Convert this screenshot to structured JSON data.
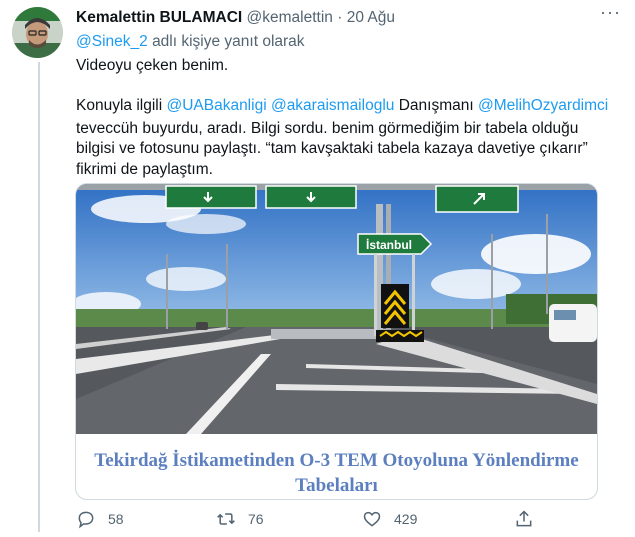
{
  "tweet": {
    "display_name": "Kemalettin BULAMACI",
    "handle": "@kemalettin",
    "separator": "·",
    "date": "20 Ağu",
    "reply_to_handle": "@Sinek_2",
    "reply_to_suffix": "adlı kişiye yanıt olarak",
    "line1": "Videoyu çeken benim.",
    "line2_prefix": "Konuyla ilgili ",
    "mention1": "@UABakanligi",
    "mention2": "@akaraismailoglu",
    "line2_mid": " Danışmanı ",
    "mention3": "@MelihOzyardimci",
    "line3": "teveccüh buyurdu, aradı. Bilgi sordu. benim görmediğim bir tabela olduğu",
    "line4": "bilgisi ve fotosunu paylaştı. “tam kavşaktaki tabela kazaya davetiye çıkarır”",
    "line5": "fikrimi de paylaştım."
  },
  "media": {
    "sign_label": "İstanbul",
    "caption_line1": "Tekirdağ İstikametinden O-3 TEM Otoyoluna Yönlendirme",
    "caption_line2": "Tabelaları"
  },
  "actions": {
    "reply_count": "58",
    "retweet_count": "76",
    "like_count": "429"
  },
  "colors": {
    "link": "#1d9bf0",
    "muted": "#536471",
    "caption": "#5b7fbf",
    "sign_green": "#1f7a3d"
  }
}
